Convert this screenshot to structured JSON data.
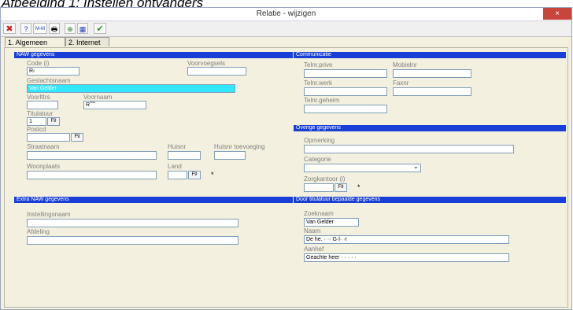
{
  "caption": "Afbeelding 1: Instellen ontvangers",
  "window": {
    "title": "Relatie - wijzigen",
    "close": "×"
  },
  "toolbar": {
    "cancel": "✖",
    "help": "?",
    "mm": "M-M",
    "print": "🖶",
    "link": "⊕",
    "grid": "▦",
    "ok": "✔"
  },
  "tabs": [
    {
      "label": "1. Algemeen"
    },
    {
      "label": "2. Internet"
    }
  ],
  "naw": {
    "header": "NAW gegevens",
    "code_label": "Code (i)",
    "code_value": "R‹",
    "voorvoegsels_label": "Voorvoegsels",
    "geslachtsnaam_label": "Geslachtsnaam",
    "geslachtsnaam_value": "Van Gelder",
    "voorlttrs_label": "Voorlttrs",
    "voornaam_label": "Voornaam",
    "voornaam_value": "R˜˜˜",
    "titulatuur_label": "Titulatuur",
    "titulatuur_value": "1",
    "postcd_label": "Postcd",
    "straatnaam_label": "Straatnaam",
    "huisnr_label": "Huisnr",
    "huisnr_toevoeging_label": "Huisnr toevoeging",
    "woonplaats_label": "Woonplaats",
    "land_label": "Land",
    "f9": "F9",
    "required": "*"
  },
  "extra": {
    "header": "Extra NAW gegevens",
    "instellingsnaam_label": "Instellingsnaam",
    "afdeling_label": "Afdeling"
  },
  "comm": {
    "header": "Communicatie",
    "telnr_prive_label": "Telnr.prive",
    "mobielnr_label": "Mobielnr",
    "telnr_werk_label": "Telnr.werk",
    "faxnr_label": "Faxnr",
    "telnr_geheim_label": "Telnr.geheim"
  },
  "overige": {
    "header": "Overige gegevens",
    "opmerking_label": "Opmerking",
    "categorie_label": "Categorie",
    "categorie_arrow": "⌄",
    "zorgkantoor_label": "Zorgkantoor (i)"
  },
  "titulatuur_sectie": {
    "header": "Door titulatuur bepaalde gegevens",
    "zoeknaam_label": "Zoeknaam",
    "zoeknaam_value": "Van Gelder",
    "naam_label": "Naam",
    "naam_value": "De he.   ·  ·· G·l· ·r",
    "aanhef_label": "Aanhef",
    "aanhef_value": "Geachte heer          · · · · ·"
  }
}
